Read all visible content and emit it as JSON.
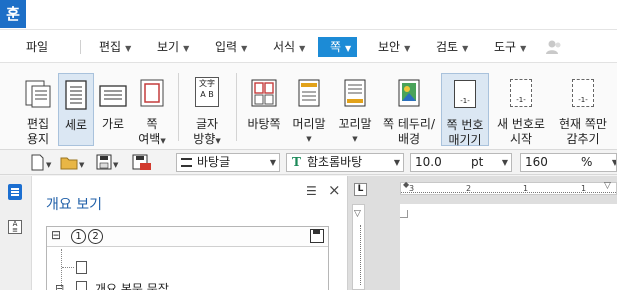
{
  "app": {
    "icon_glyph": "훈"
  },
  "menu": {
    "file": "파일",
    "edit": "편집",
    "view": "보기",
    "input": "입력",
    "format": "서식",
    "page": "쪽",
    "security": "보안",
    "review": "검토",
    "tools": "도구"
  },
  "ribbon": {
    "edit_page_1": "편집",
    "edit_page_2": "용지",
    "portrait": "세로",
    "landscape": "가로",
    "margin_1": "쪽",
    "margin_2": "여백",
    "text_dir_1": "글자",
    "text_dir_2": "방향",
    "background": "바탕쪽",
    "header": "머리말",
    "footer": "꼬리말",
    "border_1": "쪽 테두리/",
    "border_2": "배경",
    "page_num_1": "쪽 번호",
    "page_num_2": "매기기",
    "new_num_1": "새 번호로",
    "new_num_2": "시작",
    "hide_1": "현재 쪽만",
    "hide_2": "감추기",
    "text_dir_glyph_1": "文字",
    "text_dir_glyph_2": "A B",
    "page_num_glyph": "-1-",
    "new_num_glyph": "-1-",
    "hide_glyph": "-1-"
  },
  "toolbar": {
    "style": "바탕글",
    "font": "함초롬바탕",
    "font_icon": "T",
    "size": "10.0",
    "size_unit": "pt",
    "zoom": "160",
    "zoom_unit": "%"
  },
  "pane": {
    "title": "개요 보기",
    "level1": "1",
    "level2": "2",
    "item_text": "개요 본문 문장",
    "expand_glyph": "⊟",
    "close_glyph": "×",
    "menu_glyph": "☰"
  },
  "ruler": {
    "t1": "1",
    "t2": "2",
    "t3": "3",
    "t4": "1",
    "corner": "L"
  },
  "colors": {
    "accent": "#1c8bd6",
    "brand": "#1d6fc7",
    "title": "#1f5fa8"
  }
}
